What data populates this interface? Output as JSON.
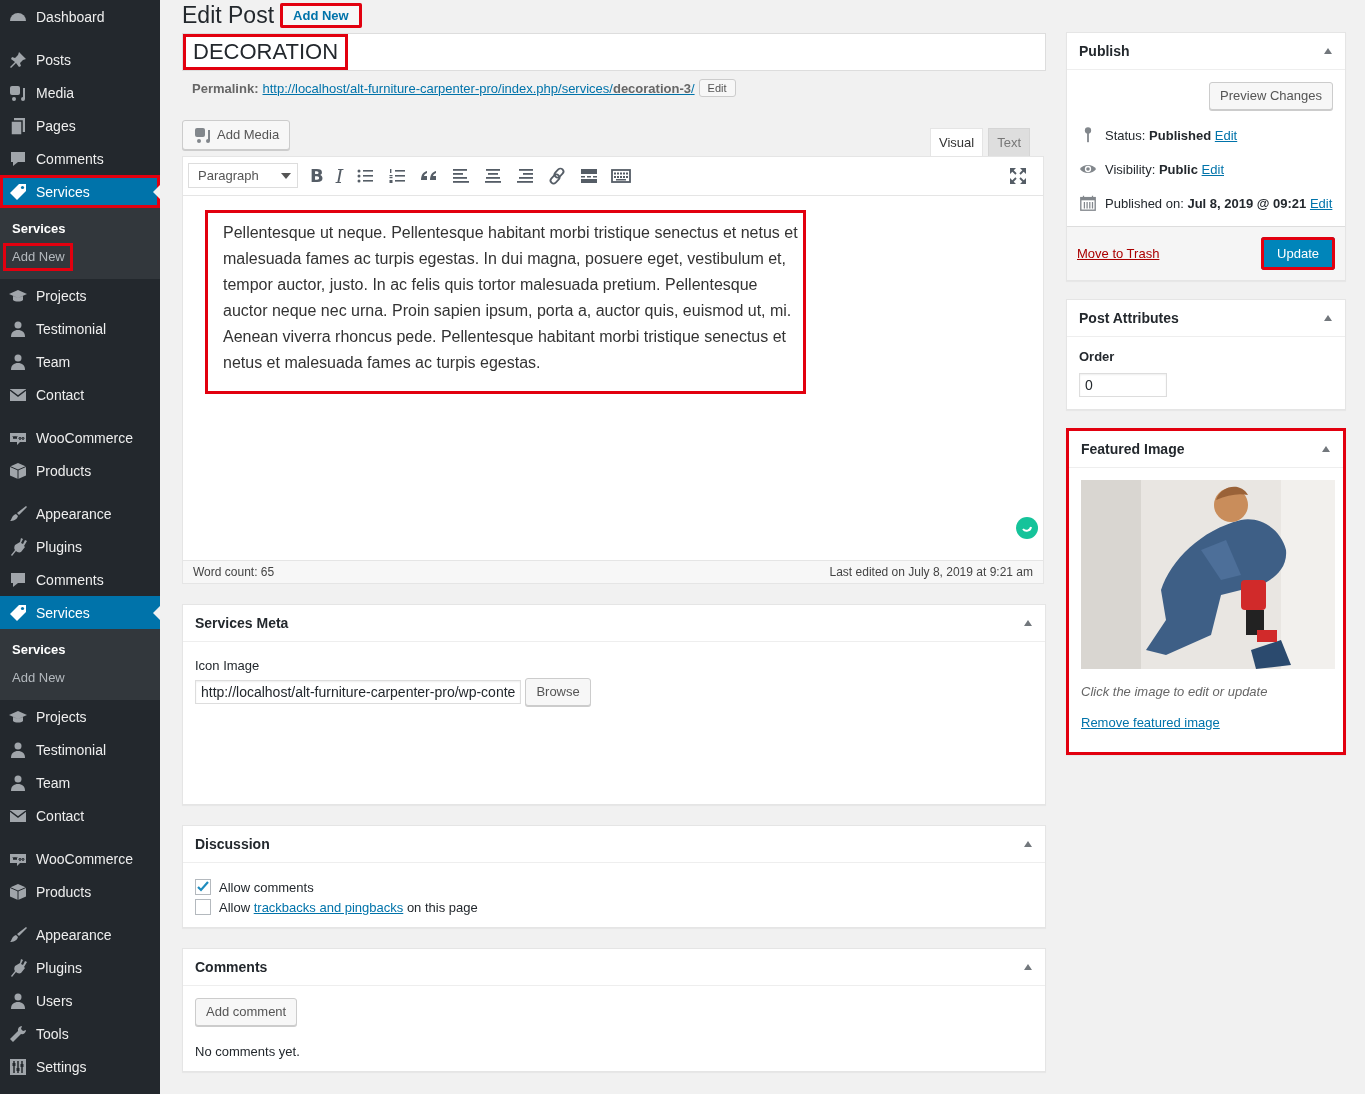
{
  "admin_menu_groups": [
    {
      "items": [
        {
          "label": "Dashboard",
          "selected": false,
          "highlighted": false
        }
      ]
    },
    {
      "items": [
        {
          "label": "Posts",
          "selected": false,
          "highlighted": false
        },
        {
          "label": "Media",
          "selected": false,
          "highlighted": false
        },
        {
          "label": "Pages",
          "selected": false,
          "highlighted": false
        },
        {
          "label": "Comments",
          "selected": false,
          "highlighted": false
        },
        {
          "label": "Services",
          "selected": true,
          "highlighted": true,
          "submenu": [
            {
              "label": "Services",
              "selected": true,
              "highlighted": false
            },
            {
              "label": "Add New",
              "selected": false,
              "highlighted": true
            }
          ]
        },
        {
          "label": "Projects",
          "selected": false,
          "highlighted": false
        },
        {
          "label": "Testimonial",
          "selected": false,
          "highlighted": false
        },
        {
          "label": "Team",
          "selected": false,
          "highlighted": false
        },
        {
          "label": "Contact",
          "selected": false,
          "highlighted": false
        }
      ]
    },
    {
      "items": [
        {
          "label": "WooCommerce",
          "selected": false,
          "highlighted": false
        },
        {
          "label": "Products",
          "selected": false,
          "highlighted": false
        }
      ]
    },
    {
      "items": [
        {
          "label": "Appearance",
          "selected": false,
          "highlighted": false
        },
        {
          "label": "Plugins",
          "selected": false,
          "highlighted": false
        },
        {
          "label": "Comments",
          "selected": false,
          "highlighted": false
        },
        {
          "label": "Services",
          "selected": true,
          "highlighted": false,
          "submenu": [
            {
              "label": "Services",
              "selected": true,
              "highlighted": false
            },
            {
              "label": "Add New",
              "selected": false,
              "highlighted": false
            }
          ]
        },
        {
          "label": "Projects",
          "selected": false,
          "highlighted": false
        },
        {
          "label": "Testimonial",
          "selected": false,
          "highlighted": false
        },
        {
          "label": "Team",
          "selected": false,
          "highlighted": false
        },
        {
          "label": "Contact",
          "selected": false,
          "highlighted": false
        }
      ]
    },
    {
      "items": [
        {
          "label": "WooCommerce",
          "selected": false,
          "highlighted": false
        },
        {
          "label": "Products",
          "selected": false,
          "highlighted": false
        }
      ]
    },
    {
      "items": [
        {
          "label": "Appearance",
          "selected": false,
          "highlighted": false
        },
        {
          "label": "Plugins",
          "selected": false,
          "highlighted": false
        },
        {
          "label": "Users",
          "selected": false,
          "highlighted": false
        },
        {
          "label": "Tools",
          "selected": false,
          "highlighted": false
        },
        {
          "label": "Settings",
          "selected": false,
          "highlighted": false
        }
      ]
    }
  ],
  "page": {
    "heading": "Edit Post",
    "add_new": {
      "label": "Add New",
      "highlighted": true
    }
  },
  "title": {
    "value": "DECORATION",
    "highlighted": true
  },
  "permalink": {
    "label": "Permalink:",
    "url": "http://localhost/alt-furniture-carpenter-pro/index.php/services/**decoration-3**/",
    "edit_button": "Edit"
  },
  "editor": {
    "add_media": "Add Media",
    "tabs": [
      {
        "label": "Visual",
        "selected": true
      },
      {
        "label": "Text",
        "selected": false
      }
    ],
    "format_select": "Paragraph",
    "toolbar": [
      {
        "kind": "bold",
        "label": "B"
      },
      {
        "kind": "italic",
        "label": "I"
      },
      {
        "kind": "bullet-list"
      },
      {
        "kind": "numbered-list"
      },
      {
        "kind": "quote"
      },
      {
        "kind": "align-left"
      },
      {
        "kind": "align-center"
      },
      {
        "kind": "align-right"
      },
      {
        "kind": "link"
      },
      {
        "kind": "more"
      },
      {
        "kind": "toolbar-toggle"
      },
      {
        "kind": "fullscreen"
      }
    ],
    "content": "Pellentesque ut neque. Pellentesque habitant morbi tristique senectus et netus et malesuada fames ac turpis egestas. In dui magna, posuere eget, vestibulum et, tempor auctor, justo. In ac felis quis tortor malesuada pretium. Pellentesque auctor neque nec urna. Proin sapien ipsum, porta a, auctor quis, euismod ut, mi. Aenean viverra rhoncus pede. Pellentesque habitant morbi tristique senectus et netus et malesuada fames ac turpis egestas.",
    "content_highlighted": true,
    "word_count": "Word count: 65",
    "last_edited": "Last edited on July 8, 2019 at 9:21 am"
  },
  "services_meta": {
    "title": "Services Meta",
    "field_label": "Icon Image",
    "field_value": "http://localhost/alt-furniture-carpenter-pro/wp-conte",
    "browse": "Browse"
  },
  "discussion": {
    "title": "Discussion",
    "options": [
      {
        "checked": true,
        "text": "Allow comments"
      },
      {
        "checked": false,
        "text": "Allow ",
        "link": "trackbacks and pingbacks",
        "text_after": " on this page"
      }
    ]
  },
  "comments": {
    "title": "Comments",
    "add_button": "Add comment",
    "empty_text": "No comments yet."
  },
  "publish": {
    "title": "Publish",
    "preview_button": "Preview Changes",
    "rows": [
      {
        "kind": "status",
        "text": "Status: **Published**",
        "link": "Edit"
      },
      {
        "kind": "visibility",
        "text": "Visibility: **Public**",
        "link": "Edit"
      },
      {
        "kind": "date",
        "text": "Published on: **Jul 8, 2019 @ 09:21**",
        "link": "Edit"
      }
    ],
    "trash_link": "Move to Trash",
    "update": {
      "label": "Update",
      "highlighted": true
    }
  },
  "post_attributes": {
    "title": "Post Attributes",
    "order_label": "Order",
    "order_value": "0"
  },
  "featured_image": {
    "title": "Featured Image",
    "highlighted": true,
    "hint": "Click the image to edit or update",
    "remove_link": "Remove featured image"
  }
}
